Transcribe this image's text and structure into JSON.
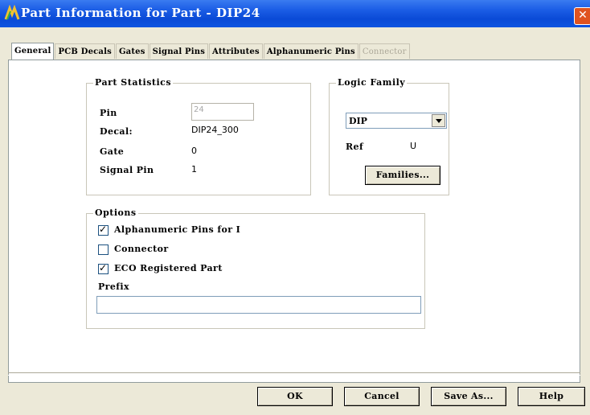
{
  "window": {
    "title": "Part Information for Part - DIP24",
    "close_glyph": "✕"
  },
  "tabs": [
    {
      "label": "General",
      "active": true
    },
    {
      "label": "PCB Decals",
      "active": false
    },
    {
      "label": "Gates",
      "active": false
    },
    {
      "label": "Signal Pins",
      "active": false
    },
    {
      "label": "Attributes",
      "active": false
    },
    {
      "label": "Alphanumeric Pins",
      "active": false
    },
    {
      "label": "Connector",
      "active": false,
      "disabled": true
    }
  ],
  "part_statistics": {
    "legend": "Part Statistics",
    "pin_label": "Pin",
    "pin_value": "24",
    "decal_label": "Decal:",
    "decal_value": "DIP24_300",
    "gate_label": "Gate",
    "gate_value": "0",
    "signal_pin_label": "Signal Pin",
    "signal_pin_value": "1"
  },
  "logic_family": {
    "legend": "Logic Family",
    "selected": "DIP",
    "ref_label": "Ref",
    "ref_value": "U",
    "families_button": "Families..."
  },
  "options": {
    "legend": "Options",
    "alphanumeric_label": "Alphanumeric Pins for I",
    "alphanumeric_checked": true,
    "connector_label": "Connector",
    "connector_checked": false,
    "ecu_label": "ECO Registered Part",
    "ecu_checked": true,
    "prefix_label": "Prefix",
    "prefix_value": ""
  },
  "buttons": {
    "ok": "OK",
    "cancel": "Cancel",
    "save_as": "Save As...",
    "help": "Help"
  }
}
